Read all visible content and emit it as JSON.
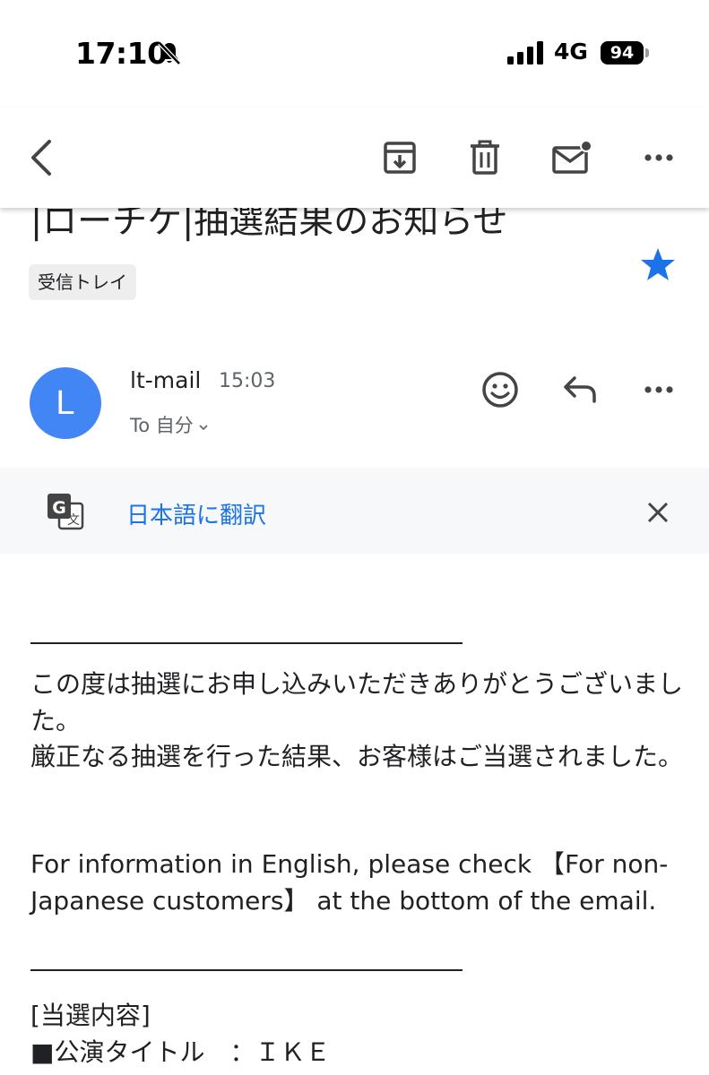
{
  "status_bar": {
    "time": "17:10",
    "network": "4G",
    "battery": "94"
  },
  "email": {
    "subject": "|ローチケ|抽選結果のお知らせ",
    "label": "受信トレイ",
    "starred": true,
    "sender": {
      "initial": "L",
      "name": "lt-mail",
      "time": "15:03",
      "recipient": "To 自分"
    },
    "translate": {
      "text": "日本語に翻訳"
    },
    "body": {
      "paragraph_1": "この度は抽選にお申し込みいただきありがとうございました。",
      "paragraph_2": "厳正なる抽選を行った結果、お客様はご当選されました。",
      "paragraph_3": "For information in English, please check 【For non-Japanese customers】 at the bottom of the email.",
      "section_heading": "[当選内容]",
      "item_1": "■公演タイトル　：ＩＫＥ"
    }
  },
  "colors": {
    "accent": "#1a73e8",
    "avatar": "#4285f4",
    "star": "#1a73e8",
    "translate_bar": "#f7f8fa"
  }
}
